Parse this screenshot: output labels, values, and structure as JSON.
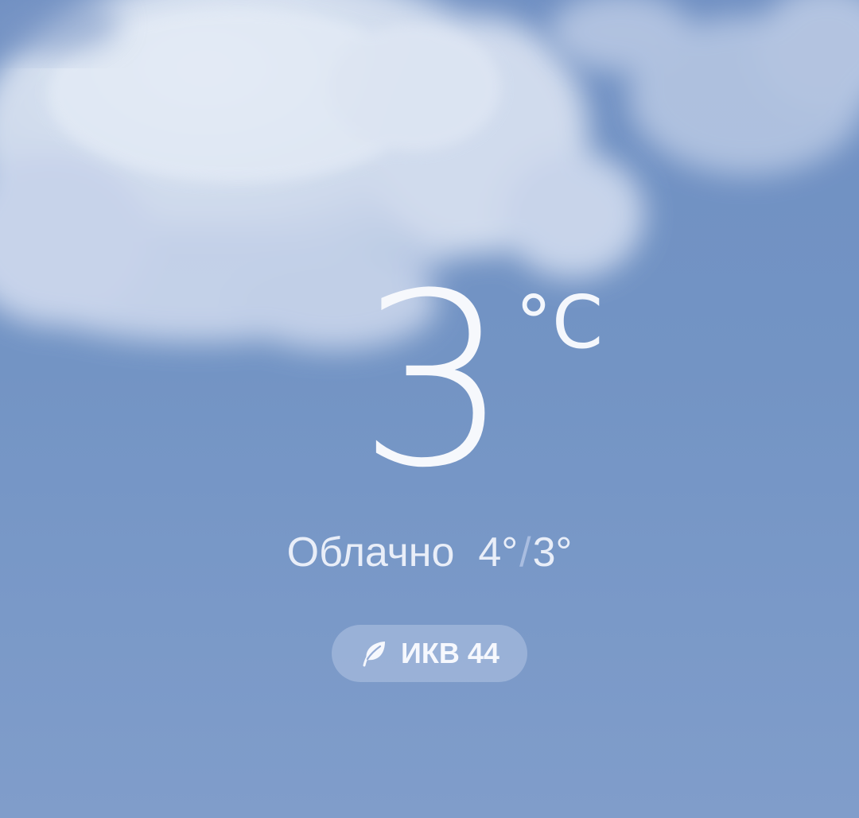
{
  "weather": {
    "temperature": "3",
    "unit": "°C",
    "condition": "Облачно",
    "high": "4°",
    "separator": "/",
    "low": "3°",
    "aqi_label": "ИКВ 44"
  },
  "icons": {
    "aqi": "leaf-icon",
    "background": "cloud-icon"
  },
  "colors": {
    "sky": "#7394c4",
    "text": "#f6f8fc",
    "pill": "#aabfe0"
  }
}
